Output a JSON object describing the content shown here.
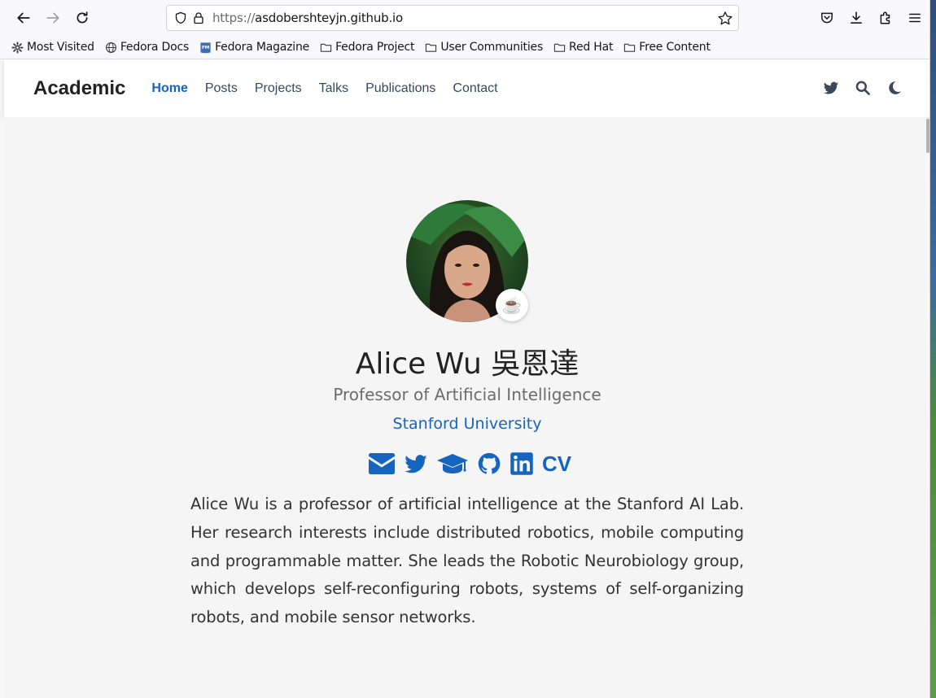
{
  "browser": {
    "url_scheme": "https://",
    "url_host": "asdobershteyjn.github.io",
    "bookmarks": [
      {
        "label": "Most Visited",
        "icon": "gear-icon"
      },
      {
        "label": "Fedora Docs",
        "icon": "globe-icon"
      },
      {
        "label": "Fedora Magazine",
        "icon": "fedora-magazine-icon"
      },
      {
        "label": "Fedora Project",
        "icon": "folder-icon"
      },
      {
        "label": "User Communities",
        "icon": "folder-icon"
      },
      {
        "label": "Red Hat",
        "icon": "folder-icon"
      },
      {
        "label": "Free Content",
        "icon": "folder-icon"
      }
    ]
  },
  "site": {
    "brand": "Academic",
    "nav": [
      {
        "label": "Home",
        "active": true
      },
      {
        "label": "Posts"
      },
      {
        "label": "Projects"
      },
      {
        "label": "Talks"
      },
      {
        "label": "Publications"
      },
      {
        "label": "Contact"
      }
    ],
    "accent_color": "#1565c0"
  },
  "profile": {
    "status_emoji": "☕",
    "name": "Alice Wu 吳恩達",
    "role": "Professor of Artificial Intelligence",
    "organization": "Stanford University",
    "cv_label": "CV",
    "bio": "Alice Wu is a professor of artificial intelligence at the Stanford AI Lab. Her research interests include distributed robotics, mobile computing and programmable matter. She leads the Robotic Neurobiology group, which develops self-reconfiguring robots, systems of self-organizing robots, and mobile sensor networks."
  }
}
